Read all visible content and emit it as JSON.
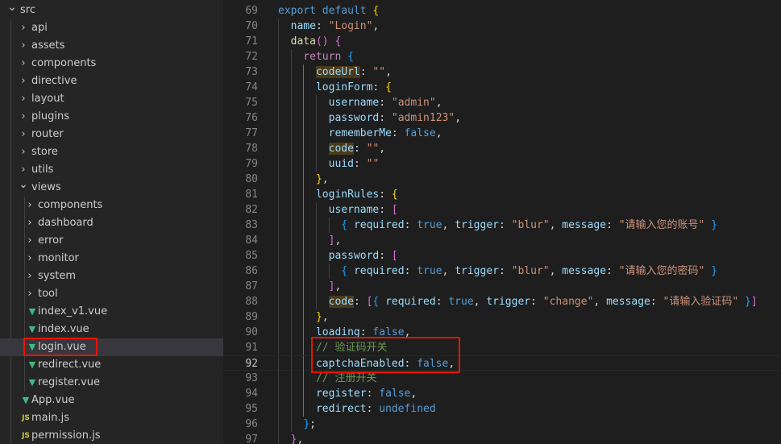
{
  "explorer": {
    "items": [
      {
        "label": "src",
        "kind": "folder",
        "open": true,
        "depth": 0
      },
      {
        "label": "api",
        "kind": "folder",
        "open": false,
        "depth": 1
      },
      {
        "label": "assets",
        "kind": "folder",
        "open": false,
        "depth": 1
      },
      {
        "label": "components",
        "kind": "folder",
        "open": false,
        "depth": 1
      },
      {
        "label": "directive",
        "kind": "folder",
        "open": false,
        "depth": 1
      },
      {
        "label": "layout",
        "kind": "folder",
        "open": false,
        "depth": 1
      },
      {
        "label": "plugins",
        "kind": "folder",
        "open": false,
        "depth": 1
      },
      {
        "label": "router",
        "kind": "folder",
        "open": false,
        "depth": 1
      },
      {
        "label": "store",
        "kind": "folder",
        "open": false,
        "depth": 1
      },
      {
        "label": "utils",
        "kind": "folder",
        "open": false,
        "depth": 1
      },
      {
        "label": "views",
        "kind": "folder",
        "open": true,
        "depth": 1
      },
      {
        "label": "components",
        "kind": "folder",
        "open": false,
        "depth": 2
      },
      {
        "label": "dashboard",
        "kind": "folder",
        "open": false,
        "depth": 2
      },
      {
        "label": "error",
        "kind": "folder",
        "open": false,
        "depth": 2
      },
      {
        "label": "monitor",
        "kind": "folder",
        "open": false,
        "depth": 2
      },
      {
        "label": "system",
        "kind": "folder",
        "open": false,
        "depth": 2
      },
      {
        "label": "tool",
        "kind": "folder",
        "open": false,
        "depth": 2
      },
      {
        "label": "index_v1.vue",
        "kind": "vue",
        "depth": 2
      },
      {
        "label": "index.vue",
        "kind": "vue",
        "depth": 2
      },
      {
        "label": "login.vue",
        "kind": "vue",
        "depth": 2,
        "selected": true
      },
      {
        "label": "redirect.vue",
        "kind": "vue",
        "depth": 2
      },
      {
        "label": "register.vue",
        "kind": "vue",
        "depth": 2
      },
      {
        "label": "App.vue",
        "kind": "vue",
        "depth": 1
      },
      {
        "label": "main.js",
        "kind": "js",
        "depth": 1
      },
      {
        "label": "permission.js",
        "kind": "js",
        "depth": 1
      }
    ],
    "icons": {
      "folder_closed": "chevron-right-icon",
      "folder_open": "chevron-down-icon",
      "vue": "vue-file-icon",
      "js": "js-file-icon"
    },
    "icon_glyphs": {
      "vue": "▼",
      "js": "JS"
    }
  },
  "editor": {
    "active_line": 92,
    "lines": [
      {
        "num": "69",
        "indent": 0,
        "tokens": [
          [
            "kw",
            "export"
          ],
          [
            "",
            "·"
          ],
          [
            "kw",
            "default"
          ],
          [
            "",
            "·"
          ],
          [
            "br1",
            "{"
          ]
        ]
      },
      {
        "num": "70",
        "indent": 1,
        "tokens": [
          [
            "prop",
            "name"
          ],
          [
            "",
            ":·"
          ],
          [
            "str",
            "\"Login\""
          ],
          [
            "",
            ","
          ]
        ]
      },
      {
        "num": "71",
        "indent": 1,
        "tokens": [
          [
            "fn",
            "data"
          ],
          [
            "br2",
            "()"
          ],
          [
            "",
            "·"
          ],
          [
            "br2",
            "{"
          ]
        ]
      },
      {
        "num": "72",
        "indent": 2,
        "tokens": [
          [
            "ctl",
            "return"
          ],
          [
            "",
            "·"
          ],
          [
            "br3",
            "{"
          ]
        ]
      },
      {
        "num": "73",
        "indent": 3,
        "tokens": [
          [
            "prop hl",
            "codeUrl"
          ],
          [
            "",
            ":·"
          ],
          [
            "str",
            "\"\""
          ],
          [
            "",
            ","
          ]
        ]
      },
      {
        "num": "74",
        "indent": 3,
        "tokens": [
          [
            "prop",
            "loginForm"
          ],
          [
            "",
            ":·"
          ],
          [
            "br1",
            "{"
          ]
        ]
      },
      {
        "num": "75",
        "indent": 4,
        "tokens": [
          [
            "prop",
            "username"
          ],
          [
            "",
            ":·"
          ],
          [
            "str",
            "\"admin\""
          ],
          [
            "",
            ","
          ]
        ]
      },
      {
        "num": "76",
        "indent": 4,
        "tokens": [
          [
            "prop",
            "password"
          ],
          [
            "",
            ":·"
          ],
          [
            "str",
            "\"admin123\""
          ],
          [
            "",
            ","
          ]
        ]
      },
      {
        "num": "77",
        "indent": 4,
        "tokens": [
          [
            "prop",
            "rememberMe"
          ],
          [
            "",
            ":·"
          ],
          [
            "kw",
            "false"
          ],
          [
            "",
            ","
          ]
        ]
      },
      {
        "num": "78",
        "indent": 4,
        "tokens": [
          [
            "prop hl",
            "code"
          ],
          [
            "",
            ":·"
          ],
          [
            "str",
            "\"\""
          ],
          [
            "",
            ","
          ]
        ]
      },
      {
        "num": "79",
        "indent": 4,
        "tokens": [
          [
            "prop",
            "uuid"
          ],
          [
            "",
            ":·"
          ],
          [
            "str",
            "\"\""
          ]
        ]
      },
      {
        "num": "80",
        "indent": 3,
        "tokens": [
          [
            "br1",
            "}"
          ],
          [
            "",
            ","
          ]
        ]
      },
      {
        "num": "81",
        "indent": 3,
        "tokens": [
          [
            "prop",
            "loginRules"
          ],
          [
            "",
            ":·"
          ],
          [
            "br1",
            "{"
          ]
        ]
      },
      {
        "num": "82",
        "indent": 4,
        "tokens": [
          [
            "prop",
            "username"
          ],
          [
            "",
            ":·"
          ],
          [
            "br2",
            "["
          ]
        ]
      },
      {
        "num": "83",
        "indent": 5,
        "tokens": [
          [
            "br3",
            "{"
          ],
          [
            "",
            "·"
          ],
          [
            "prop",
            "required"
          ],
          [
            "",
            ":·"
          ],
          [
            "kw",
            "true"
          ],
          [
            "",
            ",·"
          ],
          [
            "prop",
            "trigger"
          ],
          [
            "",
            ":·"
          ],
          [
            "str",
            "\"blur\""
          ],
          [
            "",
            ",·"
          ],
          [
            "prop",
            "message"
          ],
          [
            "",
            ":·"
          ],
          [
            "str",
            "\"请输入您的账号\""
          ],
          [
            "",
            "·"
          ],
          [
            "br3",
            "}"
          ]
        ]
      },
      {
        "num": "84",
        "indent": 4,
        "tokens": [
          [
            "br2",
            "]"
          ],
          [
            "",
            ","
          ]
        ]
      },
      {
        "num": "85",
        "indent": 4,
        "tokens": [
          [
            "prop",
            "password"
          ],
          [
            "",
            ":·"
          ],
          [
            "br2",
            "["
          ]
        ]
      },
      {
        "num": "86",
        "indent": 5,
        "tokens": [
          [
            "br3",
            "{"
          ],
          [
            "",
            "·"
          ],
          [
            "prop",
            "required"
          ],
          [
            "",
            ":·"
          ],
          [
            "kw",
            "true"
          ],
          [
            "",
            ",·"
          ],
          [
            "prop",
            "trigger"
          ],
          [
            "",
            ":·"
          ],
          [
            "str",
            "\"blur\""
          ],
          [
            "",
            ",·"
          ],
          [
            "prop",
            "message"
          ],
          [
            "",
            ":·"
          ],
          [
            "str",
            "\"请输入您的密码\""
          ],
          [
            "",
            "·"
          ],
          [
            "br3",
            "}"
          ]
        ]
      },
      {
        "num": "87",
        "indent": 4,
        "tokens": [
          [
            "br2",
            "]"
          ],
          [
            "",
            ","
          ]
        ]
      },
      {
        "num": "88",
        "indent": 4,
        "tokens": [
          [
            "prop hl",
            "code"
          ],
          [
            "",
            ":·"
          ],
          [
            "br2",
            "["
          ],
          [
            "br3",
            "{"
          ],
          [
            "",
            "·"
          ],
          [
            "prop",
            "required"
          ],
          [
            "",
            ":·"
          ],
          [
            "kw",
            "true"
          ],
          [
            "",
            ",·"
          ],
          [
            "prop",
            "trigger"
          ],
          [
            "",
            ":·"
          ],
          [
            "str",
            "\"change\""
          ],
          [
            "",
            ",·"
          ],
          [
            "prop",
            "message"
          ],
          [
            "",
            ":·"
          ],
          [
            "str",
            "\"请输入验证码\""
          ],
          [
            "",
            "·"
          ],
          [
            "br3",
            "}"
          ],
          [
            "br2",
            "]"
          ]
        ]
      },
      {
        "num": "89",
        "indent": 3,
        "tokens": [
          [
            "br1",
            "}"
          ],
          [
            "",
            ","
          ]
        ]
      },
      {
        "num": "90",
        "indent": 3,
        "tokens": [
          [
            "prop",
            "loading"
          ],
          [
            "",
            ":·"
          ],
          [
            "kw",
            "false"
          ],
          [
            "",
            ","
          ]
        ]
      },
      {
        "num": "91",
        "indent": 3,
        "tokens": [
          [
            "cmt",
            "//·验证码开关"
          ]
        ]
      },
      {
        "num": "92",
        "indent": 3,
        "tokens": [
          [
            "prop",
            "captchaEnabled"
          ],
          [
            "",
            ":·"
          ],
          [
            "kw",
            "false"
          ],
          [
            "",
            ","
          ]
        ]
      },
      {
        "num": "93",
        "indent": 3,
        "tokens": [
          [
            "cmt",
            "//·注册开关"
          ]
        ]
      },
      {
        "num": "94",
        "indent": 3,
        "tokens": [
          [
            "prop",
            "register"
          ],
          [
            "",
            ":·"
          ],
          [
            "kw",
            "false"
          ],
          [
            "",
            ","
          ]
        ]
      },
      {
        "num": "95",
        "indent": 3,
        "tokens": [
          [
            "prop",
            "redirect"
          ],
          [
            "",
            ":·"
          ],
          [
            "kw",
            "undefined"
          ]
        ]
      },
      {
        "num": "96",
        "indent": 2,
        "tokens": [
          [
            "br3",
            "}"
          ],
          [
            "",
            ";"
          ]
        ]
      },
      {
        "num": "97",
        "indent": 1,
        "tokens": [
          [
            "br2",
            "}"
          ],
          [
            "",
            ","
          ]
        ]
      }
    ]
  },
  "colors": {
    "annotation_box": "#e51400",
    "editor_bg": "#1e1e1e",
    "sidebar_bg": "#252526"
  }
}
